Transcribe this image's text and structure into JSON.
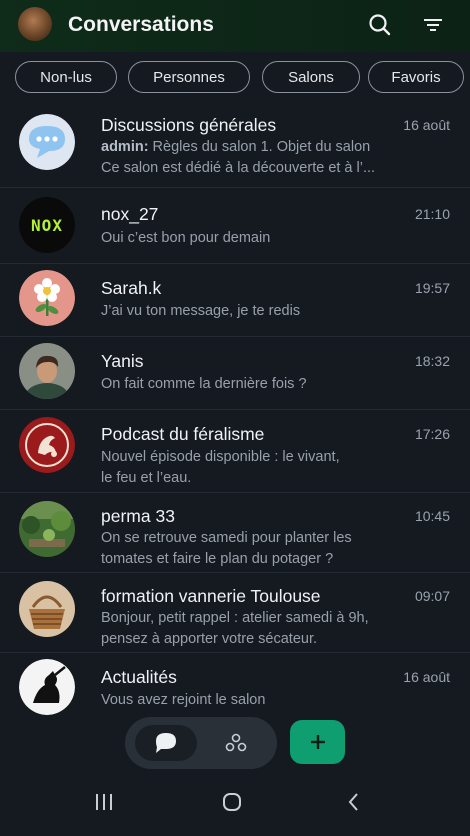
{
  "header": {
    "title": "Conversations"
  },
  "filters": [
    "Non-lus",
    "Personnes",
    "Salons",
    "Favoris"
  ],
  "conversations": [
    {
      "name": "Discussions générales",
      "time": "16 août",
      "sender": "admin:",
      "line1": " Règles du salon 1. Objet du salon",
      "line2": "Ce salon est dédié à la découverte et à l’..."
    },
    {
      "name": "nox_27",
      "time": "21:10",
      "line1": "Oui c’est bon pour demain",
      "avatar_text": "NOX"
    },
    {
      "name": "Sarah.k",
      "time": "19:57",
      "line1": "J’ai vu ton message, je te redis"
    },
    {
      "name": "Yanis",
      "time": "18:32",
      "line1": "On fait comme la dernière fois ?"
    },
    {
      "name": "Podcast du féralisme",
      "time": "17:26",
      "line1": "Nouvel épisode disponible : le vivant,",
      "line2": "le feu et l’eau."
    },
    {
      "name": "perma 33",
      "time": "10:45",
      "line1": "On se retrouve samedi pour planter les",
      "line2": "tomates et faire le plan du potager ?"
    },
    {
      "name": "formation vannerie Toulouse",
      "time": "09:07",
      "line1": "Bonjour, petit rappel : atelier samedi à 9h,",
      "line2": "pensez à apporter votre sécateur."
    },
    {
      "name": "Actualités",
      "time": "16 août",
      "line1": "Vous avez rejoint le salon"
    }
  ],
  "colors": {
    "accent": "#0e9e6f",
    "header_bg": "#0f2b19",
    "background": "#151a21"
  },
  "icons": [
    "search-icon",
    "filter-icon",
    "chat-bubble-icon",
    "people-icon",
    "plus-icon",
    "recent-apps-icon",
    "home-icon",
    "back-icon"
  ]
}
